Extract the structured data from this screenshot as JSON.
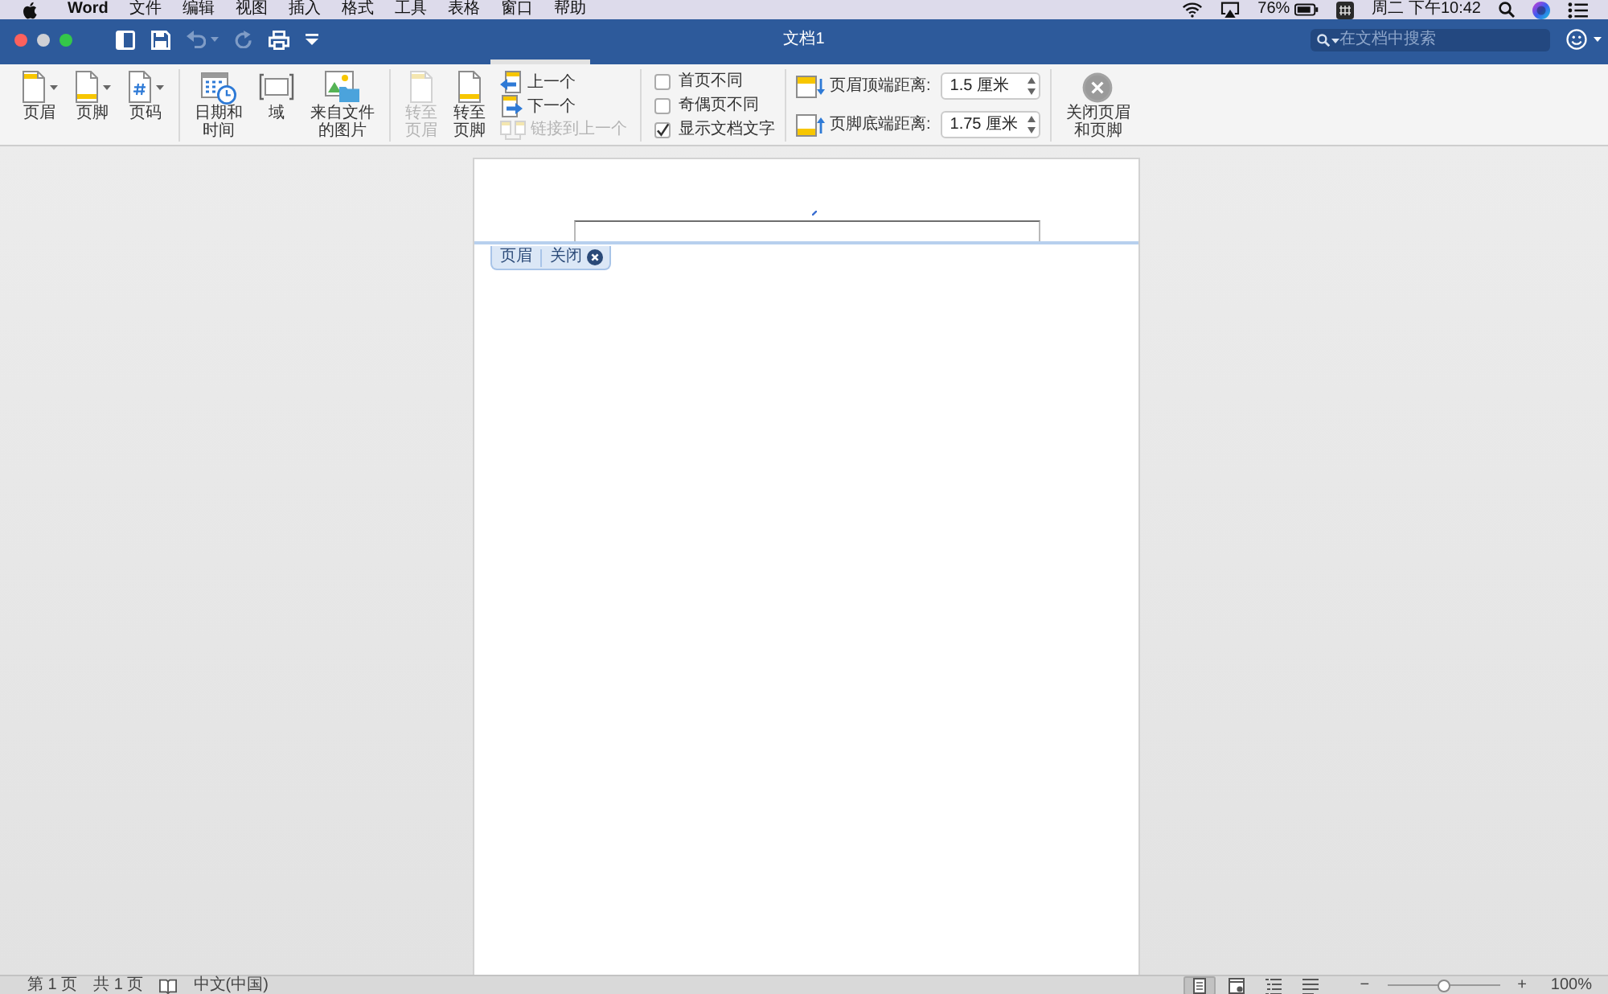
{
  "menu_bar": {
    "app_name": "Word",
    "menus": [
      "文件",
      "编辑",
      "视图",
      "插入",
      "格式",
      "工具",
      "表格",
      "窗口",
      "帮助"
    ],
    "battery_text": "76%",
    "clock": "周二 下午10:42"
  },
  "title_bar": {
    "window_controls": [
      {
        "kind": "close",
        "disabled": false
      },
      {
        "kind": "minimize",
        "disabled": true
      },
      {
        "kind": "zoom",
        "disabled": false
      }
    ],
    "quick_access": [
      {
        "kind": "sidebar",
        "disabled": false,
        "dropdown": false
      },
      {
        "kind": "save",
        "disabled": false,
        "dropdown": false
      },
      {
        "kind": "undo",
        "disabled": true,
        "dropdown": true
      },
      {
        "kind": "redo",
        "disabled": true,
        "dropdown": false
      },
      {
        "kind": "print",
        "disabled": false,
        "dropdown": false
      },
      {
        "kind": "customize",
        "disabled": false,
        "dropdown": false
      }
    ],
    "title": "文档1",
    "search": {
      "placeholder": "在文档中搜索"
    }
  },
  "ribbon": {
    "groups": [
      {
        "items": [
          {
            "kind": "header",
            "label": "页眉",
            "dropdown": true,
            "disabled": false
          },
          {
            "kind": "footer",
            "label": "页脚",
            "dropdown": true,
            "disabled": false
          },
          {
            "kind": "pagenumber",
            "label": "页码",
            "dropdown": true,
            "disabled": false
          }
        ]
      },
      {
        "items": [
          {
            "kind": "datetime",
            "label": "日期和时间",
            "dropdown": false,
            "disabled": false
          },
          {
            "kind": "field",
            "label": "域",
            "dropdown": false,
            "disabled": false
          },
          {
            "kind": "picture",
            "label": "来自文件的图片",
            "dropdown": false,
            "disabled": false
          }
        ]
      },
      {
        "items": [
          {
            "kind": "gotoheader",
            "label": "转至页眉",
            "dropdown": false,
            "disabled": true
          },
          {
            "kind": "gotofooter",
            "label": "转至页脚",
            "dropdown": false,
            "disabled": false
          },
          {
            "kind": "previous",
            "label": "上一个",
            "disabled": false
          },
          {
            "kind": "next",
            "label": "下一个",
            "disabled": false
          },
          {
            "kind": "linkprevious",
            "label": "链接到上一个",
            "disabled": true
          }
        ]
      },
      {
        "items": [
          {
            "kind": "checkbox",
            "label": "首页不同",
            "checked": false
          },
          {
            "kind": "checkbox",
            "label": "奇偶页不同",
            "checked": false
          },
          {
            "kind": "checkbox",
            "label": "显示文档文字",
            "checked": true
          }
        ]
      },
      {
        "items": [
          {
            "kind": "headerdistance",
            "label": "页眉顶端距离:",
            "value": "1.5 厘米"
          },
          {
            "kind": "footerdistance",
            "label": "页脚底端距离:",
            "value": "1.75 厘米"
          }
        ]
      },
      {
        "items": [
          {
            "kind": "closeheader",
            "label": "关闭页眉和页脚",
            "dropdown": false,
            "disabled": false
          }
        ]
      }
    ]
  },
  "document": {
    "header_tag": {
      "label": "页眉",
      "close": "关闭"
    }
  },
  "status_bar": {
    "page": "第 1 页",
    "page_count": "共 1 页",
    "language": "中文(中国)",
    "views": [
      {
        "kind": "page",
        "selected": true
      },
      {
        "kind": "web",
        "selected": false
      },
      {
        "kind": "outline",
        "selected": false
      },
      {
        "kind": "draft",
        "selected": false
      }
    ],
    "zoom_out": "−",
    "zoom": {
      "level": 0.5
    },
    "zoom_in": "+",
    "zoom_text": "100%"
  }
}
